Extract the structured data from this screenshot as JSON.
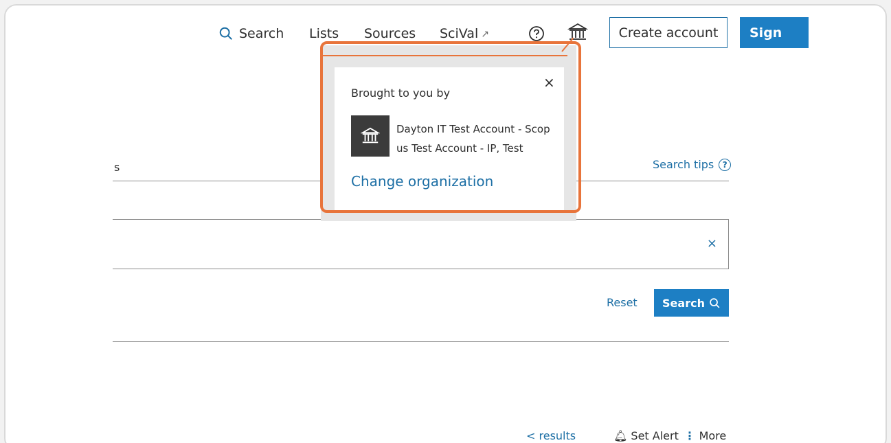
{
  "nav": {
    "search_label": "Search",
    "lists_label": "Lists",
    "sources_label": "Sources",
    "scival_label": "SciVal",
    "scival_ext_glyph": "↗",
    "create_account_label": "Create account",
    "sign_in_label": "Sign"
  },
  "search_form": {
    "field_label_fragment": "s",
    "search_tips_label": "Search tips",
    "help_glyph": "?",
    "clear_glyph": "×",
    "reset_label": "Reset",
    "search_button_label": "Search"
  },
  "bottom": {
    "results_label": "< results",
    "set_alert_label": "Set Alert",
    "more_label": "More"
  },
  "popover": {
    "close_glyph": "×",
    "brought_to_you_by": "Brought to you by",
    "organization_name": "Dayton IT Test Account - Scopus Test Account - IP, Test",
    "change_organization_label": "Change organization"
  },
  "colors": {
    "accent_blue": "#1d7fc4",
    "link_blue": "#1d6fa5",
    "highlight_orange": "#e8743b",
    "org_icon_bg": "#3b3b3b"
  },
  "icons": {
    "search": "magnifier-icon",
    "help": "question-circle-icon",
    "institution": "institution-icon",
    "external": "external-link-icon",
    "close": "close-icon"
  }
}
